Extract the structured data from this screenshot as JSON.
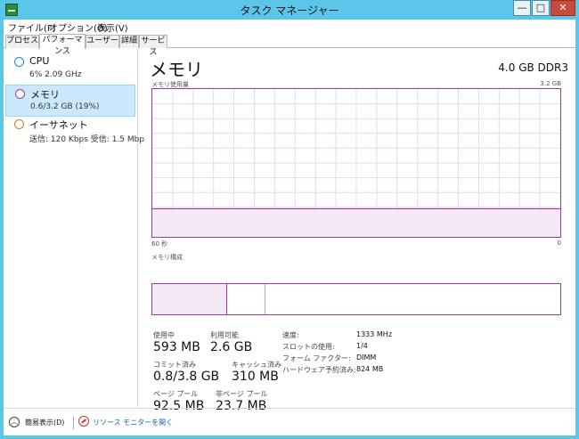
{
  "window": {
    "title": "タスク マネージャー",
    "controls": {
      "minimize": "—",
      "maximize": "□",
      "close": "✕"
    }
  },
  "menu": [
    "ファイル(F)",
    "オプション(O)",
    "表示(V)"
  ],
  "tabs": [
    {
      "label": "プロセス",
      "active": false
    },
    {
      "label": "パフォーマンス",
      "active": true
    },
    {
      "label": "ユーザー",
      "active": false
    },
    {
      "label": "詳細",
      "active": false
    },
    {
      "label": "サービス",
      "active": false
    }
  ],
  "sidebar": [
    {
      "name": "CPU",
      "detail": "6% 2.09 GHz",
      "selected": false,
      "icon_color": "#1e88c8"
    },
    {
      "name": "メモリ",
      "detail": "0.6/3.2 GB (19%)",
      "selected": true,
      "icon_color": "#9b3a9b"
    },
    {
      "name": "イーサネット",
      "detail": "送信: 120 Kbps 受信: 1.5 Mbp",
      "selected": false,
      "icon_color": "#c77a2a"
    }
  ],
  "main": {
    "title": "メモリ",
    "spec": "4.0 GB DDR3",
    "usage_label": "メモリ使用量",
    "usage_max": "3.2 GB",
    "axis_left": "60 秒",
    "axis_right": "0",
    "composition_label": "メモリ構成",
    "usage_fraction": 0.19,
    "accent_color": "#9b3a9b"
  },
  "stats": {
    "in_use": {
      "label": "使用中",
      "value": "593 MB"
    },
    "available": {
      "label": "利用可能",
      "value": "2.6 GB"
    },
    "committed": {
      "label": "コミット済み",
      "value": "0.8/3.8 GB"
    },
    "cached": {
      "label": "キャッシュ済み",
      "value": "310 MB"
    },
    "paged_pool": {
      "label": "ページ プール",
      "value": "92.5 MB"
    },
    "nonpaged_pool": {
      "label": "非ページ プール",
      "value": "23.7 MB"
    }
  },
  "specs": [
    {
      "key": "速度:",
      "value": "1333 MHz"
    },
    {
      "key": "スロットの使用:",
      "value": "1/4"
    },
    {
      "key": "フォーム ファクター:",
      "value": "DIMM"
    },
    {
      "key": "ハードウェア予約済み:",
      "value": "824 MB"
    }
  ],
  "footer": {
    "fewer_details": "簡易表示(D)",
    "resource_monitor": "リソース モニターを開く"
  }
}
